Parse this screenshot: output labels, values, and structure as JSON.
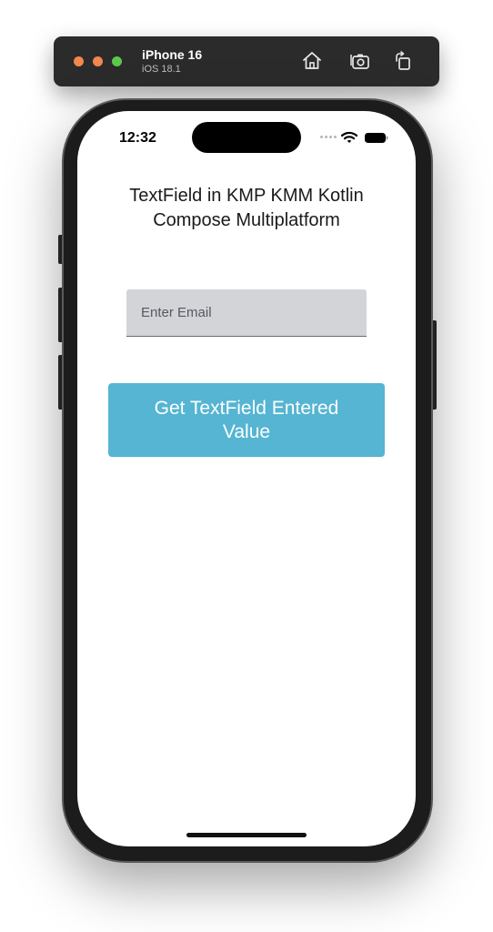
{
  "simulator": {
    "device_name": "iPhone 16",
    "os_version": "iOS 18.1",
    "icons": [
      "home-icon",
      "screenshot-icon",
      "rotate-icon"
    ]
  },
  "status_bar": {
    "time": "12:32",
    "icons": [
      "signal-dots-icon",
      "wifi-icon",
      "battery-icon"
    ]
  },
  "app": {
    "heading_line1": "TextField in KMP KMM Kotlin",
    "heading_line2": "Compose Multiplatform",
    "email_field": {
      "placeholder": "Enter Email",
      "value": ""
    },
    "button_label": "Get TextField Entered Value",
    "colors": {
      "button_bg": "#55b5d2",
      "field_bg": "#d2d4d8"
    }
  }
}
